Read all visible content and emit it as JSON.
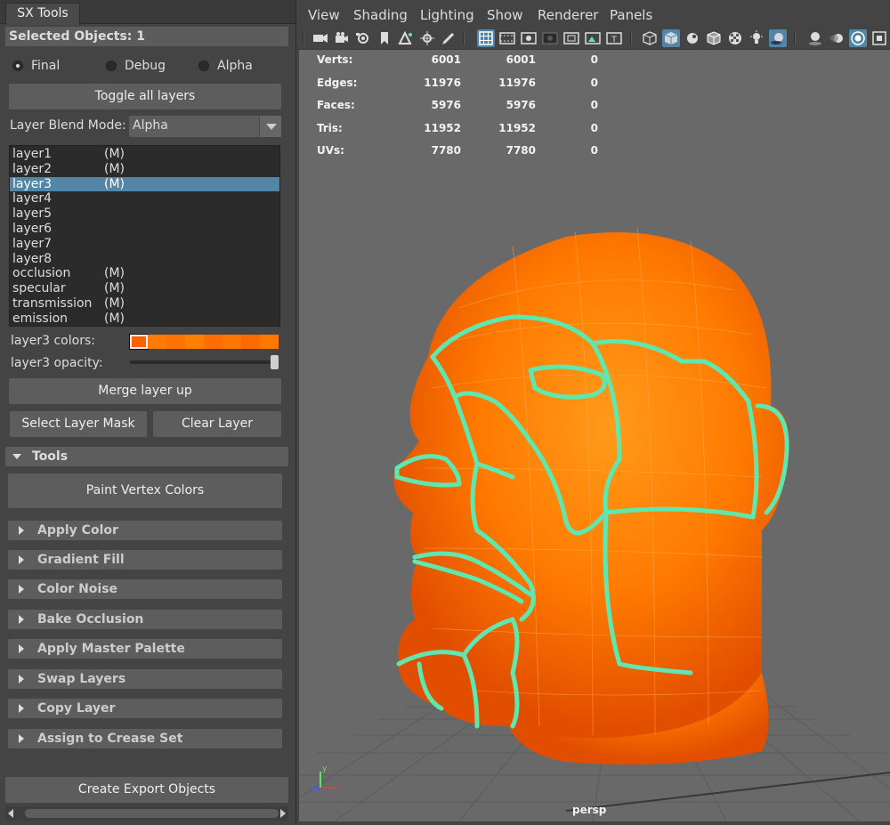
{
  "panel": {
    "tab": "SX Tools",
    "selected_header": "Selected Objects: 1",
    "modes": [
      {
        "label": "Final",
        "selected": true
      },
      {
        "label": "Debug",
        "selected": false
      },
      {
        "label": "Alpha",
        "selected": false
      }
    ],
    "toggle_all_layers": "Toggle all layers",
    "blend_mode_label": "Layer Blend Mode:",
    "blend_mode_value": "Alpha",
    "layers": [
      {
        "name": "layer1",
        "flag": "(M)",
        "selected": false
      },
      {
        "name": "layer2",
        "flag": "(M)",
        "selected": false
      },
      {
        "name": "layer3",
        "flag": "(M)",
        "selected": true
      },
      {
        "name": "layer4",
        "flag": "",
        "selected": false
      },
      {
        "name": "layer5",
        "flag": "",
        "selected": false
      },
      {
        "name": "layer6",
        "flag": "",
        "selected": false
      },
      {
        "name": "layer7",
        "flag": "",
        "selected": false
      },
      {
        "name": "layer8",
        "flag": "",
        "selected": false
      },
      {
        "name": "occlusion",
        "flag": "(M)",
        "selected": false
      },
      {
        "name": "specular",
        "flag": "(M)",
        "selected": false
      },
      {
        "name": "transmission",
        "flag": "(M)",
        "selected": false
      },
      {
        "name": "emission",
        "flag": "(M)",
        "selected": false
      }
    ],
    "colors_label": "layer3 colors:",
    "layer_colors": [
      "#ff6100",
      "#ff7a06",
      "#ff7200",
      "#ff8000",
      "#ff6e00",
      "#ff7600",
      "#ff6a00",
      "#ff7800"
    ],
    "opacity_label": "layer3 opacity:",
    "opacity": 1.0,
    "merge_layer_up": "Merge layer up",
    "select_layer_mask": "Select Layer Mask",
    "clear_layer": "Clear Layer",
    "tools_header": "Tools",
    "paint_vertex_colors": "Paint Vertex Colors",
    "tool_sections": [
      "Apply Color",
      "Gradient Fill",
      "Color Noise",
      "Bake Occlusion",
      "Apply Master Palette",
      "Swap Layers",
      "Copy Layer",
      "Assign to Crease Set"
    ],
    "create_export_objects": "Create Export Objects"
  },
  "viewport": {
    "menus": [
      "View",
      "Shading",
      "Lighting",
      "Show",
      "Renderer",
      "Panels"
    ],
    "toolbar_icons": [
      "camera-icon",
      "camera-attributes-icon",
      "camera-lock-icon",
      "bookmark-icon",
      "image-plane-icon",
      "2d-pan-zoom-icon",
      "grease-pencil-icon",
      "grid-icon",
      "film-gate-icon",
      "resolution-gate-icon",
      "gate-mask-icon",
      "field-chart-icon",
      "safe-action-icon",
      "safe-title-icon",
      "wireframe-icon",
      "smooth-shade-icon",
      "use-default-material-icon",
      "wireframe-on-shaded-icon",
      "textured-icon",
      "lighting-icon",
      "shadows-icon",
      "ambient-occlusion-icon",
      "motion-blur-icon",
      "anti-aliasing-icon",
      "depth-of-field-icon"
    ],
    "hud": [
      {
        "label": "Verts:",
        "a": "6001",
        "b": "6001",
        "c": "0"
      },
      {
        "label": "Edges:",
        "a": "11976",
        "b": "11976",
        "c": "0"
      },
      {
        "label": "Faces:",
        "a": "5976",
        "b": "5976",
        "c": "0"
      },
      {
        "label": "Tris:",
        "a": "11952",
        "b": "11952",
        "c": "0"
      },
      {
        "label": "UVs:",
        "a": "7780",
        "b": "7780",
        "c": "0"
      }
    ],
    "camera_label": "persp",
    "axis_labels": {
      "x": "x",
      "y": "y",
      "z": "z"
    },
    "colors": {
      "mesh": "#ff7a00",
      "crease": "#5ee8b0",
      "background": "#696969"
    }
  }
}
